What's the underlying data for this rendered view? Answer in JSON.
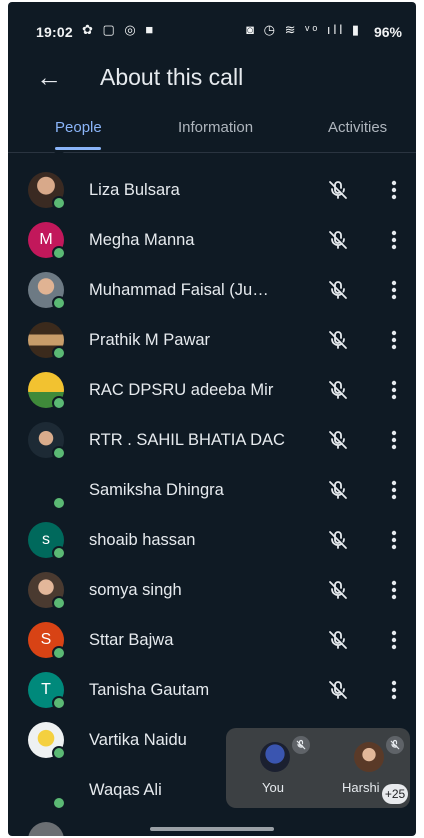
{
  "status_bar": {
    "time": "19:02",
    "left_icons": "✿ ▢ ◎ ■",
    "right_icons": "◙ ◷ ≋ ᵛᵒ ıll ▮",
    "battery": "96%"
  },
  "header": {
    "title": "About this call"
  },
  "tabs": [
    {
      "label": "People"
    },
    {
      "label": "Information"
    },
    {
      "label": "Activities"
    }
  ],
  "participants": [
    {
      "name": "Liza Bulsara"
    },
    {
      "name": "Megha Manna",
      "initial": "M"
    },
    {
      "name": "Muhammad Faisal (Ju…"
    },
    {
      "name": "Prathik M Pawar"
    },
    {
      "name": "RAC DPSRU adeeba Mir"
    },
    {
      "name": "RTR . SAHIL BHATIA DAC"
    },
    {
      "name": "Samiksha Dhingra"
    },
    {
      "name": "shoaib hassan",
      "initial": "s"
    },
    {
      "name": "somya singh"
    },
    {
      "name": "Sttar Bajwa",
      "initial": "S"
    },
    {
      "name": "Tanisha Gautam",
      "initial": "T"
    },
    {
      "name": "Vartika Naidu"
    },
    {
      "name": "Waqas Ali"
    }
  ],
  "pip": {
    "tile1": "You",
    "tile2": "Harshi",
    "extra_count": "+25"
  },
  "colors": {
    "background": "#0f1a24",
    "accent": "#8ab4f8",
    "online_dot": "#5bb974"
  }
}
